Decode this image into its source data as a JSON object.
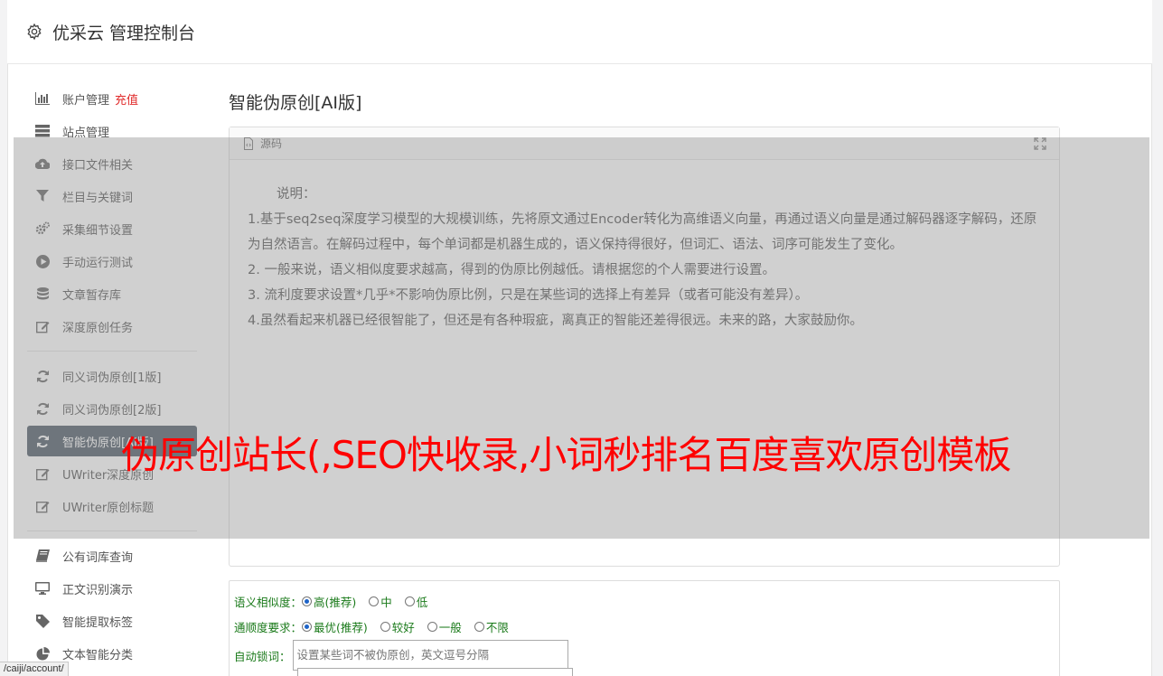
{
  "header": {
    "title": "优采云 管理控制台",
    "icon": "gear-icon"
  },
  "sidebar": {
    "group1": [
      {
        "label": "账户管理",
        "badge": "充值",
        "icon": "bar-chart-icon"
      },
      {
        "label": "站点管理",
        "icon": "server-icon"
      },
      {
        "label": "接口文件相关",
        "icon": "cloud-upload-icon"
      },
      {
        "label": "栏目与关键词",
        "icon": "filter-icon"
      },
      {
        "label": "采集细节设置",
        "icon": "cogs-icon"
      },
      {
        "label": "手动运行测试",
        "icon": "play-circle-icon"
      },
      {
        "label": "文章暂存库",
        "icon": "database-icon"
      },
      {
        "label": "深度原创任务",
        "icon": "edit-icon"
      }
    ],
    "group2": [
      {
        "label": "同义词伪原创[1版]",
        "icon": "refresh-icon"
      },
      {
        "label": "同义词伪原创[2版]",
        "icon": "refresh-icon"
      },
      {
        "label": "智能伪原创[AI版]",
        "icon": "refresh-icon",
        "active": true
      },
      {
        "label": "UWriter深度原创",
        "icon": "edit-icon"
      },
      {
        "label": "UWriter原创标题",
        "icon": "edit-icon"
      }
    ],
    "group3": [
      {
        "label": "公有词库查询",
        "icon": "book-icon"
      },
      {
        "label": "正文识别演示",
        "icon": "monitor-icon"
      },
      {
        "label": "智能提取标签",
        "icon": "tag-icon"
      },
      {
        "label": "文本智能分类",
        "icon": "pie-chart-icon"
      }
    ]
  },
  "main": {
    "title": "智能伪原创[AI版]",
    "editor": {
      "source_label": "源码",
      "lines": [
        "说明：",
        "1.基于seq2seq深度学习模型的大规模训练，先将原文通过Encoder转化为高维语义向量，再通过语义向量是通过解码器逐字解码，还原为自然语言。在解码过程中，每个单词都是机器生成的，语义保持得很好，但词汇、语法、词序可能发生了变化。",
        "2. 一般来说，语义相似度要求越高，得到的伪原比例越低。请根据您的个人需要进行设置。",
        "3. 流利度要求设置*几乎*不影响伪原比例，只是在某些词的选择上有差异（或者可能没有差异）。",
        "4.虽然看起来机器已经很智能了，但还是有各种瑕疵，离真正的智能还差得很远。未来的路，大家鼓励你。"
      ]
    },
    "settings": {
      "similarity_label": "语义相似度：",
      "similarity_options": [
        "高(推荐)",
        "中",
        "低"
      ],
      "similarity_selected": "高(推荐)",
      "fluency_label": "通顺度要求：",
      "fluency_options": [
        "最优(推荐)",
        "较好",
        "一般",
        "不限"
      ],
      "fluency_selected": "最优(推荐)",
      "lock_label": "自动锁词：",
      "lock_placeholder": "设置某些词不被伪原创，英文逗号分隔"
    }
  },
  "overlay_text": "伪原创站长(,SEO快收录,小词秒排名百度喜欢原创模板",
  "statusbar": "/caiji/account/"
}
